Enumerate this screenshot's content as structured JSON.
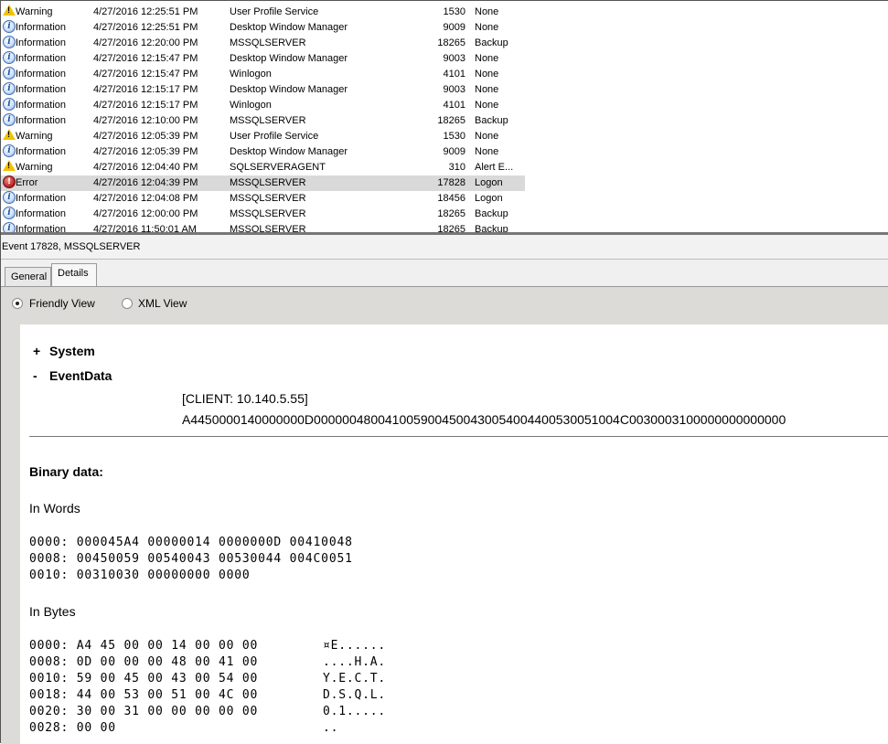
{
  "events": [
    {
      "level": "Warning",
      "icon": "warning-icon",
      "date": "4/27/2016 12:25:51 PM",
      "source": "User Profile Service",
      "id": "1530",
      "task": "None"
    },
    {
      "level": "Information",
      "icon": "information-icon",
      "date": "4/27/2016 12:25:51 PM",
      "source": "Desktop Window Manager",
      "id": "9009",
      "task": "None"
    },
    {
      "level": "Information",
      "icon": "information-icon",
      "date": "4/27/2016 12:20:00 PM",
      "source": "MSSQLSERVER",
      "id": "18265",
      "task": "Backup"
    },
    {
      "level": "Information",
      "icon": "information-icon",
      "date": "4/27/2016 12:15:47 PM",
      "source": "Desktop Window Manager",
      "id": "9003",
      "task": "None"
    },
    {
      "level": "Information",
      "icon": "information-icon",
      "date": "4/27/2016 12:15:47 PM",
      "source": "Winlogon",
      "id": "4101",
      "task": "None"
    },
    {
      "level": "Information",
      "icon": "information-icon",
      "date": "4/27/2016 12:15:17 PM",
      "source": "Desktop Window Manager",
      "id": "9003",
      "task": "None"
    },
    {
      "level": "Information",
      "icon": "information-icon",
      "date": "4/27/2016 12:15:17 PM",
      "source": "Winlogon",
      "id": "4101",
      "task": "None"
    },
    {
      "level": "Information",
      "icon": "information-icon",
      "date": "4/27/2016 12:10:00 PM",
      "source": "MSSQLSERVER",
      "id": "18265",
      "task": "Backup"
    },
    {
      "level": "Warning",
      "icon": "warning-icon",
      "date": "4/27/2016 12:05:39 PM",
      "source": "User Profile Service",
      "id": "1530",
      "task": "None"
    },
    {
      "level": "Information",
      "icon": "information-icon",
      "date": "4/27/2016 12:05:39 PM",
      "source": "Desktop Window Manager",
      "id": "9009",
      "task": "None"
    },
    {
      "level": "Warning",
      "icon": "warning-icon",
      "date": "4/27/2016 12:04:40 PM",
      "source": "SQLSERVERAGENT",
      "id": "310",
      "task": "Alert E..."
    },
    {
      "level": "Error",
      "icon": "error-icon",
      "date": "4/27/2016 12:04:39 PM",
      "source": "MSSQLSERVER",
      "id": "17828",
      "task": "Logon",
      "selected": true
    },
    {
      "level": "Information",
      "icon": "information-icon",
      "date": "4/27/2016 12:04:08 PM",
      "source": "MSSQLSERVER",
      "id": "18456",
      "task": "Logon"
    },
    {
      "level": "Information",
      "icon": "information-icon",
      "date": "4/27/2016 12:00:00 PM",
      "source": "MSSQLSERVER",
      "id": "18265",
      "task": "Backup"
    },
    {
      "level": "Information",
      "icon": "information-icon",
      "date": "4/27/2016 11:50:01 AM",
      "source": "MSSQLSERVER",
      "id": "18265",
      "task": "Backup"
    }
  ],
  "detail": {
    "header": "Event 17828, MSSQLSERVER",
    "tabs": {
      "general": "General",
      "details": "Details"
    },
    "views": {
      "friendly": "Friendly View",
      "xml": "XML View",
      "selected": "friendly"
    },
    "system": {
      "toggle": "+",
      "label": "System"
    },
    "eventdata": {
      "toggle": "-",
      "label": "EventData",
      "lines": [
        "[CLIENT: 10.140.5.55]",
        "A4450000140000000D0000004800410059004500430054004400530051004C0030003100000000000000"
      ]
    },
    "binary": {
      "title": "Binary data:",
      "words_title": "In Words",
      "words": [
        "0000: 000045A4 00000014 0000000D 00410048",
        "0008: 00450059 00540043 00530044 004C0051",
        "0010: 00310030 00000000 0000"
      ],
      "bytes_title": "In Bytes",
      "bytes": [
        {
          "hex": "0000: A4 45 00 00 14 00 00 00",
          "ascii": "¤E......"
        },
        {
          "hex": "0008: 0D 00 00 00 48 00 41 00",
          "ascii": "....H.A."
        },
        {
          "hex": "0010: 59 00 45 00 43 00 54 00",
          "ascii": "Y.E.C.T."
        },
        {
          "hex": "0018: 44 00 53 00 51 00 4C 00",
          "ascii": "D.S.Q.L."
        },
        {
          "hex": "0020: 30 00 31 00 00 00 00 00",
          "ascii": "0.1....."
        },
        {
          "hex": "0028: 00 00",
          "ascii": ".."
        }
      ]
    }
  }
}
